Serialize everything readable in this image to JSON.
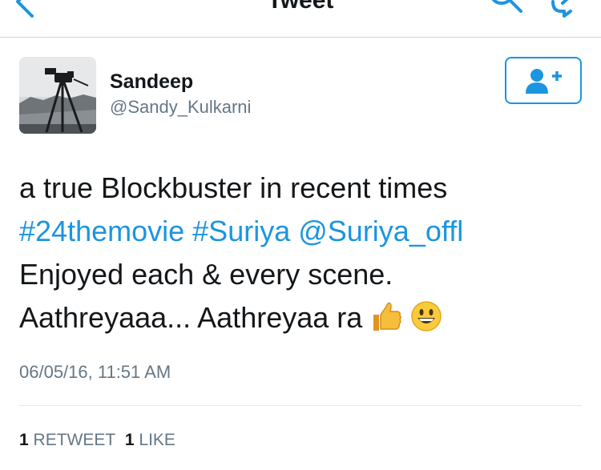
{
  "nav": {
    "title": "Tweet"
  },
  "author": {
    "display_name": "Sandeep",
    "screen_name": "@Sandy_Kulkarni"
  },
  "tweet": {
    "line1": "a true Blockbuster in recent times",
    "hashtag1": "#24themovie",
    "hashtag2": "#Suriya",
    "mention": "@Suriya_offl",
    "line3": "Enjoyed each & every scene.",
    "line4": "Aathreyaaa... Aathreyaa ra",
    "timestamp": "06/05/16, 11:51 AM"
  },
  "stats": {
    "retweet_count": "1",
    "retweet_label": "RETWEET",
    "like_count": "1",
    "like_label": "LIKE"
  },
  "icons": {
    "back": "chevron-left-icon",
    "search": "search-icon",
    "compose": "compose-tweet-icon",
    "follow": "add-user-icon",
    "emoji1": "thumbs-up-emoji",
    "emoji2": "smiley-emoji"
  },
  "colors": {
    "accent": "#1b95e0",
    "text": "#14171a",
    "secondary_text": "#657786",
    "divider": "#e1e8ed"
  }
}
